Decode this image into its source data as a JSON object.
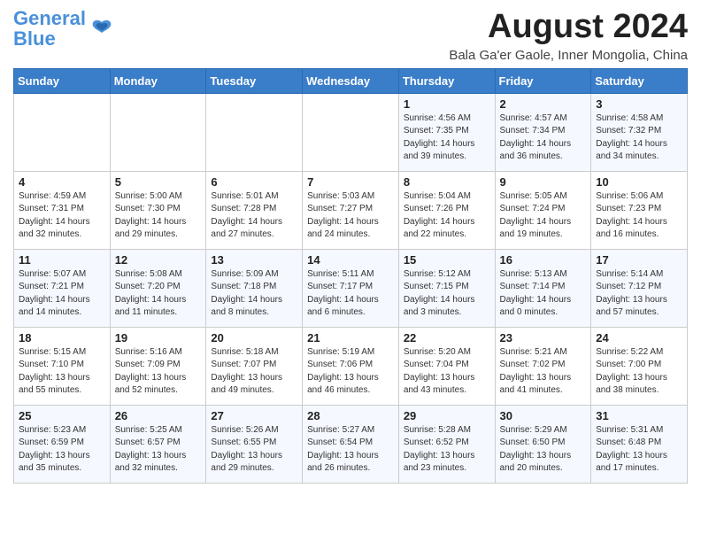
{
  "logo": {
    "line1": "General",
    "line2": "Blue"
  },
  "title": "August 2024",
  "subtitle": "Bala Ga'er Gaole, Inner Mongolia, China",
  "weekdays": [
    "Sunday",
    "Monday",
    "Tuesday",
    "Wednesday",
    "Thursday",
    "Friday",
    "Saturday"
  ],
  "weeks": [
    [
      {
        "day": "",
        "text": ""
      },
      {
        "day": "",
        "text": ""
      },
      {
        "day": "",
        "text": ""
      },
      {
        "day": "",
        "text": ""
      },
      {
        "day": "1",
        "text": "Sunrise: 4:56 AM\nSunset: 7:35 PM\nDaylight: 14 hours\nand 39 minutes."
      },
      {
        "day": "2",
        "text": "Sunrise: 4:57 AM\nSunset: 7:34 PM\nDaylight: 14 hours\nand 36 minutes."
      },
      {
        "day": "3",
        "text": "Sunrise: 4:58 AM\nSunset: 7:32 PM\nDaylight: 14 hours\nand 34 minutes."
      }
    ],
    [
      {
        "day": "4",
        "text": "Sunrise: 4:59 AM\nSunset: 7:31 PM\nDaylight: 14 hours\nand 32 minutes."
      },
      {
        "day": "5",
        "text": "Sunrise: 5:00 AM\nSunset: 7:30 PM\nDaylight: 14 hours\nand 29 minutes."
      },
      {
        "day": "6",
        "text": "Sunrise: 5:01 AM\nSunset: 7:28 PM\nDaylight: 14 hours\nand 27 minutes."
      },
      {
        "day": "7",
        "text": "Sunrise: 5:03 AM\nSunset: 7:27 PM\nDaylight: 14 hours\nand 24 minutes."
      },
      {
        "day": "8",
        "text": "Sunrise: 5:04 AM\nSunset: 7:26 PM\nDaylight: 14 hours\nand 22 minutes."
      },
      {
        "day": "9",
        "text": "Sunrise: 5:05 AM\nSunset: 7:24 PM\nDaylight: 14 hours\nand 19 minutes."
      },
      {
        "day": "10",
        "text": "Sunrise: 5:06 AM\nSunset: 7:23 PM\nDaylight: 14 hours\nand 16 minutes."
      }
    ],
    [
      {
        "day": "11",
        "text": "Sunrise: 5:07 AM\nSunset: 7:21 PM\nDaylight: 14 hours\nand 14 minutes."
      },
      {
        "day": "12",
        "text": "Sunrise: 5:08 AM\nSunset: 7:20 PM\nDaylight: 14 hours\nand 11 minutes."
      },
      {
        "day": "13",
        "text": "Sunrise: 5:09 AM\nSunset: 7:18 PM\nDaylight: 14 hours\nand 8 minutes."
      },
      {
        "day": "14",
        "text": "Sunrise: 5:11 AM\nSunset: 7:17 PM\nDaylight: 14 hours\nand 6 minutes."
      },
      {
        "day": "15",
        "text": "Sunrise: 5:12 AM\nSunset: 7:15 PM\nDaylight: 14 hours\nand 3 minutes."
      },
      {
        "day": "16",
        "text": "Sunrise: 5:13 AM\nSunset: 7:14 PM\nDaylight: 14 hours\nand 0 minutes."
      },
      {
        "day": "17",
        "text": "Sunrise: 5:14 AM\nSunset: 7:12 PM\nDaylight: 13 hours\nand 57 minutes."
      }
    ],
    [
      {
        "day": "18",
        "text": "Sunrise: 5:15 AM\nSunset: 7:10 PM\nDaylight: 13 hours\nand 55 minutes."
      },
      {
        "day": "19",
        "text": "Sunrise: 5:16 AM\nSunset: 7:09 PM\nDaylight: 13 hours\nand 52 minutes."
      },
      {
        "day": "20",
        "text": "Sunrise: 5:18 AM\nSunset: 7:07 PM\nDaylight: 13 hours\nand 49 minutes."
      },
      {
        "day": "21",
        "text": "Sunrise: 5:19 AM\nSunset: 7:06 PM\nDaylight: 13 hours\nand 46 minutes."
      },
      {
        "day": "22",
        "text": "Sunrise: 5:20 AM\nSunset: 7:04 PM\nDaylight: 13 hours\nand 43 minutes."
      },
      {
        "day": "23",
        "text": "Sunrise: 5:21 AM\nSunset: 7:02 PM\nDaylight: 13 hours\nand 41 minutes."
      },
      {
        "day": "24",
        "text": "Sunrise: 5:22 AM\nSunset: 7:00 PM\nDaylight: 13 hours\nand 38 minutes."
      }
    ],
    [
      {
        "day": "25",
        "text": "Sunrise: 5:23 AM\nSunset: 6:59 PM\nDaylight: 13 hours\nand 35 minutes."
      },
      {
        "day": "26",
        "text": "Sunrise: 5:25 AM\nSunset: 6:57 PM\nDaylight: 13 hours\nand 32 minutes."
      },
      {
        "day": "27",
        "text": "Sunrise: 5:26 AM\nSunset: 6:55 PM\nDaylight: 13 hours\nand 29 minutes."
      },
      {
        "day": "28",
        "text": "Sunrise: 5:27 AM\nSunset: 6:54 PM\nDaylight: 13 hours\nand 26 minutes."
      },
      {
        "day": "29",
        "text": "Sunrise: 5:28 AM\nSunset: 6:52 PM\nDaylight: 13 hours\nand 23 minutes."
      },
      {
        "day": "30",
        "text": "Sunrise: 5:29 AM\nSunset: 6:50 PM\nDaylight: 13 hours\nand 20 minutes."
      },
      {
        "day": "31",
        "text": "Sunrise: 5:31 AM\nSunset: 6:48 PM\nDaylight: 13 hours\nand 17 minutes."
      }
    ]
  ]
}
